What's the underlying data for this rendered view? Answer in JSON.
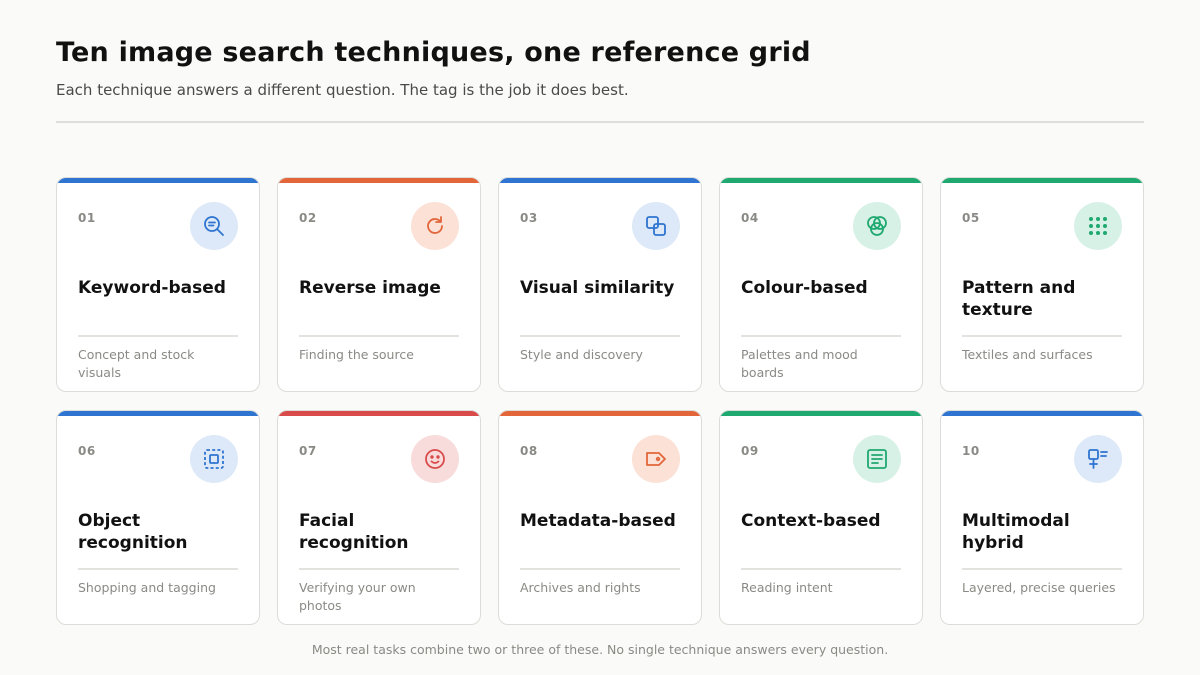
{
  "header": {
    "title": "Ten image search techniques, one reference grid",
    "subtitle": "Each technique answers a different question. The tag is the job it does best."
  },
  "colors": {
    "blue": "#2f74d0",
    "orange": "#e2663a",
    "green": "#1fa870",
    "red": "#d94b4b"
  },
  "cards": [
    {
      "number": "01",
      "name": "Keyword-based",
      "tag": "Concept and stock visuals",
      "accent": "blue",
      "icon": "search-text-icon"
    },
    {
      "number": "02",
      "name": "Reverse image",
      "tag": "Finding the source",
      "accent": "orange",
      "icon": "rotate-icon"
    },
    {
      "number": "03",
      "name": "Visual similarity",
      "tag": "Style and discovery",
      "accent": "blue",
      "icon": "overlap-squares-icon"
    },
    {
      "number": "04",
      "name": "Colour-based",
      "tag": "Palettes and mood boards",
      "accent": "green",
      "icon": "colour-circles-icon"
    },
    {
      "number": "05",
      "name": "Pattern and texture",
      "tag": "Textiles and surfaces",
      "accent": "green",
      "icon": "dot-grid-icon"
    },
    {
      "number": "06",
      "name": "Object recognition",
      "tag": "Shopping and tagging",
      "accent": "blue",
      "icon": "focus-frame-icon"
    },
    {
      "number": "07",
      "name": "Facial recognition",
      "tag": "Verifying your own photos",
      "accent": "red",
      "icon": "smiley-face-icon"
    },
    {
      "number": "08",
      "name": "Metadata-based",
      "tag": "Archives and rights",
      "accent": "orange",
      "icon": "tag-icon"
    },
    {
      "number": "09",
      "name": "Context-based",
      "tag": "Reading intent",
      "accent": "green",
      "icon": "document-lines-icon"
    },
    {
      "number": "10",
      "name": "Multimodal hybrid",
      "tag": "Layered, precise queries",
      "accent": "blue",
      "icon": "image-text-icon"
    }
  ],
  "footer": {
    "note": "Most real tasks combine two or three of these. No single technique answers every question."
  }
}
